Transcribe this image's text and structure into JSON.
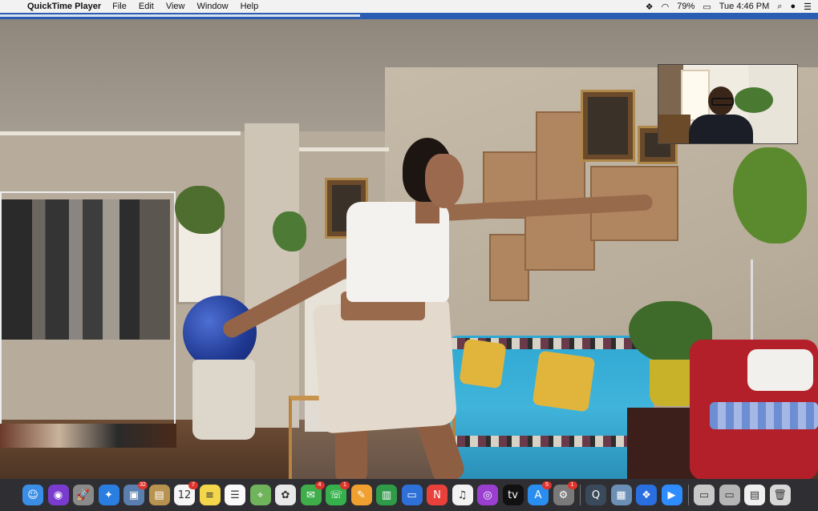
{
  "menubar": {
    "apple": "",
    "app_name": "QuickTime Player",
    "items": [
      "File",
      "Edit",
      "View",
      "Window",
      "Help"
    ],
    "status": {
      "battery": "79%",
      "clock": "Tue 4:46 PM"
    }
  },
  "player": {
    "progress_fraction": 0.44
  },
  "dock": {
    "items": [
      {
        "name": "finder",
        "glyph": "☺",
        "color": "#3a8ee6",
        "badge": ""
      },
      {
        "name": "siri",
        "glyph": "◉",
        "color": "#7a3ccf",
        "badge": ""
      },
      {
        "name": "launchpad",
        "glyph": "🚀",
        "color": "#8a8a8a",
        "badge": ""
      },
      {
        "name": "safari",
        "glyph": "✦",
        "color": "#2a7de1",
        "badge": ""
      },
      {
        "name": "preview",
        "glyph": "▣",
        "color": "#5a7fae",
        "badge": "32"
      },
      {
        "name": "notefile",
        "glyph": "▤",
        "color": "#b8934f",
        "badge": ""
      },
      {
        "name": "calendar",
        "glyph": "12",
        "color": "#f5f5f5",
        "badge": "7"
      },
      {
        "name": "notes",
        "glyph": "≡",
        "color": "#f3d64a",
        "badge": ""
      },
      {
        "name": "reminders",
        "glyph": "☰",
        "color": "#fafafa",
        "badge": ""
      },
      {
        "name": "maps",
        "glyph": "⌖",
        "color": "#6fb35a",
        "badge": ""
      },
      {
        "name": "photos",
        "glyph": "✿",
        "color": "#e8e8e8",
        "badge": ""
      },
      {
        "name": "messages",
        "glyph": "✉",
        "color": "#3fae4a",
        "badge": "4"
      },
      {
        "name": "facetime",
        "glyph": "☏",
        "color": "#35b04a",
        "badge": "1"
      },
      {
        "name": "pages",
        "glyph": "✎",
        "color": "#f0a030",
        "badge": ""
      },
      {
        "name": "numbers",
        "glyph": "▥",
        "color": "#2f9a48",
        "badge": ""
      },
      {
        "name": "keynote",
        "glyph": "▭",
        "color": "#2e6fd8",
        "badge": ""
      },
      {
        "name": "news",
        "glyph": "N",
        "color": "#e8413b",
        "badge": ""
      },
      {
        "name": "music",
        "glyph": "♫",
        "color": "#f2f2f2",
        "badge": ""
      },
      {
        "name": "podcasts",
        "glyph": "◎",
        "color": "#9a3fd0",
        "badge": ""
      },
      {
        "name": "tv",
        "glyph": "tv",
        "color": "#111111",
        "badge": ""
      },
      {
        "name": "app-store",
        "glyph": "A",
        "color": "#2a8ef0",
        "badge": "5"
      },
      {
        "name": "system-preferences",
        "glyph": "⚙",
        "color": "#7a7a7a",
        "badge": "1"
      },
      {
        "name": "separator-1",
        "glyph": "",
        "color": "",
        "badge": ""
      },
      {
        "name": "quicktime",
        "glyph": "Q",
        "color": "#3a4a5a",
        "badge": ""
      },
      {
        "name": "image-capture",
        "glyph": "▦",
        "color": "#6b8fb5",
        "badge": ""
      },
      {
        "name": "dropbox",
        "glyph": "❖",
        "color": "#2a6fe0",
        "badge": ""
      },
      {
        "name": "zoom",
        "glyph": "▶",
        "color": "#2d8cff",
        "badge": ""
      },
      {
        "name": "separator-2",
        "glyph": "",
        "color": "",
        "badge": ""
      },
      {
        "name": "folder-1",
        "glyph": "▭",
        "color": "#c8c8c8",
        "badge": ""
      },
      {
        "name": "folder-2",
        "glyph": "▭",
        "color": "#b5b5b5",
        "badge": ""
      },
      {
        "name": "document",
        "glyph": "▤",
        "color": "#efefef",
        "badge": ""
      },
      {
        "name": "trash",
        "glyph": "🗑",
        "color": "#d7d7d7",
        "badge": ""
      }
    ]
  },
  "colors": {
    "menubar_bg": "#f2f2f2",
    "titlebar_blue": "#2b5eb3",
    "dock_bg": "#2f2f33"
  }
}
